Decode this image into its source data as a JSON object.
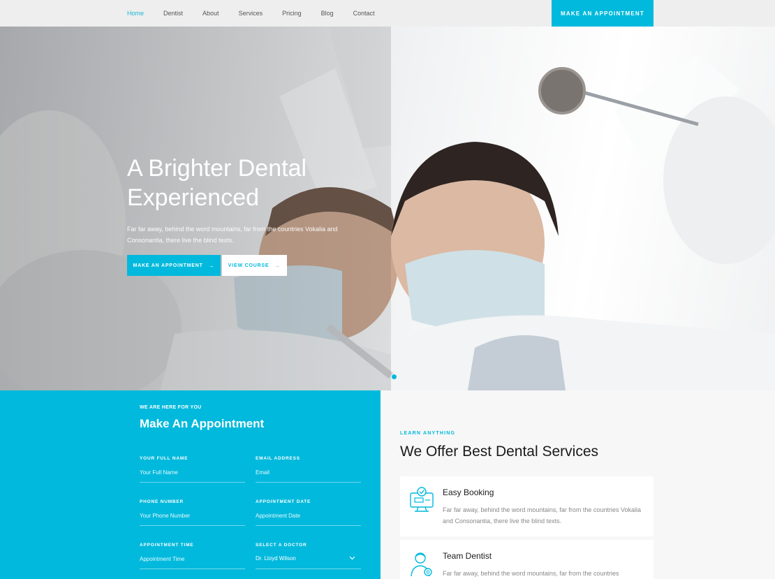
{
  "nav": {
    "items": [
      {
        "label": "Home",
        "active": true
      },
      {
        "label": "Dentist",
        "active": false
      },
      {
        "label": "About",
        "active": false
      },
      {
        "label": "Services",
        "active": false
      },
      {
        "label": "Pricing",
        "active": false
      },
      {
        "label": "Blog",
        "active": false
      },
      {
        "label": "Contact",
        "active": false
      }
    ],
    "cta_label": "MAKE AN APPOINTMENT"
  },
  "hero": {
    "title": "A Brighter Dental Experienced",
    "text": "Far far away, behind the word mountains, far from the countries Vokalia and Consonantia, there live the blind texts.",
    "primary_button": "MAKE AN APPOINTMENT",
    "secondary_button": "VIEW COURSE",
    "arrow": "→"
  },
  "appointment": {
    "kicker": "WE ARE HERE FOR YOU",
    "title": "Make An Appointment",
    "fields": {
      "full_name": {
        "label": "YOUR FULL NAME",
        "placeholder": "Your Full Name"
      },
      "email": {
        "label": "EMAIL ADDRESS",
        "placeholder": "Email"
      },
      "phone": {
        "label": "PHONE NUMBER",
        "placeholder": "Your Phone Number"
      },
      "date": {
        "label": "APPOINTMENT DATE",
        "placeholder": "Appointment Date"
      },
      "time": {
        "label": "APPOINTMENT TIME",
        "placeholder": "Appointment Time"
      },
      "doctor": {
        "label": "SELECT A DOCTOR",
        "value": "Dr. Lloyd Wilson"
      }
    }
  },
  "services": {
    "kicker": "LEARN ANYTHING",
    "title": "We Offer Best Dental Services",
    "cards": [
      {
        "title": "Easy Booking",
        "text": "Far far away, behind the word mountains, far from the countries Vokalia and Consonantia, there live the blind texts.",
        "icon": "booking-monitor-icon"
      },
      {
        "title": "Team Dentist",
        "text": "Far far away, behind the word mountains, far from the countries",
        "icon": "dentist-person-icon"
      }
    ]
  },
  "colors": {
    "accent": "#00b9dc",
    "nav_bg": "#eeeeee",
    "services_bg": "#f7f7f7"
  }
}
